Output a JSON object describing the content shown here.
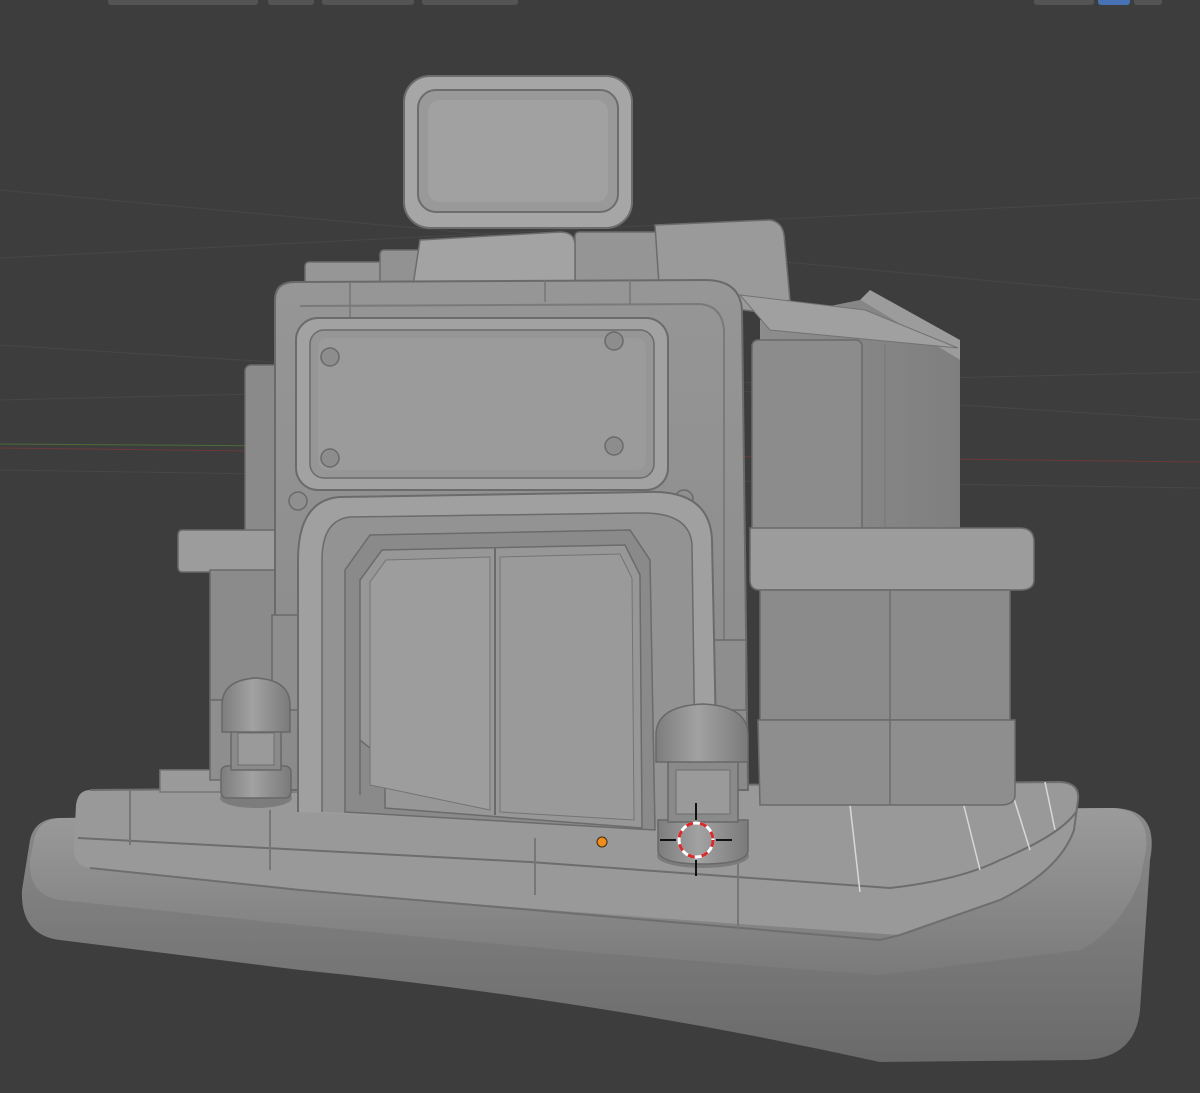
{
  "viewport": {
    "background": "#3d3d3d",
    "grid_color": "#474747",
    "x_axis_color": "#7a3b3b",
    "y_axis_color": "#4c6b38"
  },
  "model": {
    "base_color": "#8e8e8e",
    "light_color": "#a3a3a3",
    "shadow_color": "#6f6f6f",
    "edge_color": "#5a5a5a"
  },
  "icons": {
    "cursor": "3d-cursor-icon",
    "origin": "object-origin-icon"
  },
  "overlay_colors": {
    "origin": "#f08c1e",
    "cursor_ring_a": "#d92b2b",
    "cursor_ring_b": "#ffffff",
    "header_accent": "#4772b3"
  }
}
